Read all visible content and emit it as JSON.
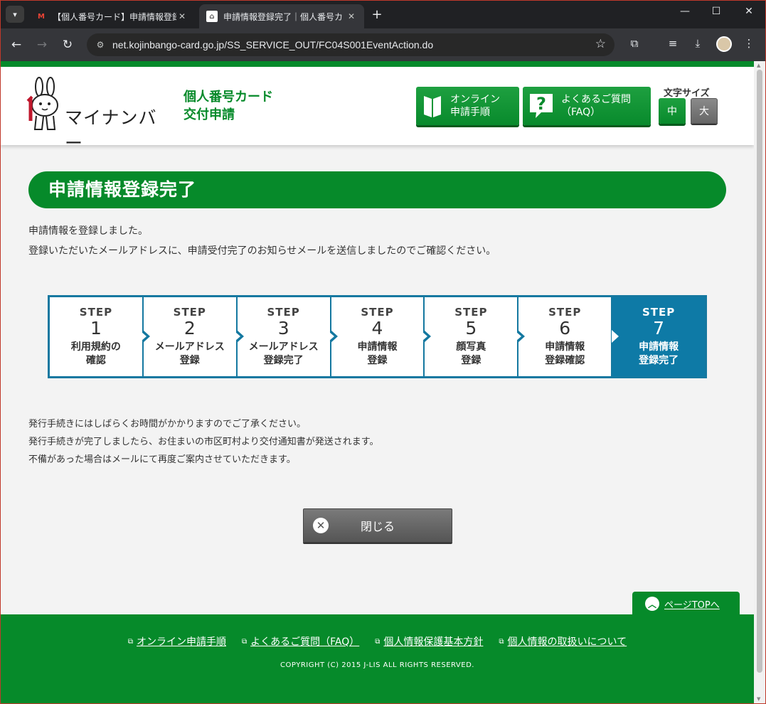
{
  "browser": {
    "tabs": [
      {
        "title": "【個人番号カード】申請情報登録U",
        "favicon": "gmail-icon",
        "active": false
      },
      {
        "title": "申請情報登録完了｜個人番号カ",
        "favicon": "site-icon",
        "active": true
      }
    ],
    "url": "net.kojinbango-card.go.jp/SS_SERVICE_OUT/FC04S001EventAction.do"
  },
  "header": {
    "logo_text": "マイナンバー",
    "service_title_line1": "個人番号カード",
    "service_title_line2": "交付申請",
    "online_btn_line1": "オンライン",
    "online_btn_line2": "申請手順",
    "faq_btn_line1": "よくあるご質問",
    "faq_btn_line2": "（FAQ）",
    "fontsize_label": "文字サイズ",
    "fontsize_medium": "中",
    "fontsize_large": "大"
  },
  "main": {
    "heading": "申請情報登録完了",
    "message1": "申請情報を登録しました。",
    "message2": "登録いただいたメールアドレスに、申請受付完了のお知らせメールを送信しましたのでご確認ください。",
    "steps": [
      {
        "word": "STEP",
        "num": "1",
        "label": "利用規約の\n確認"
      },
      {
        "word": "STEP",
        "num": "2",
        "label": "メールアドレス\n登録"
      },
      {
        "word": "STEP",
        "num": "3",
        "label": "メールアドレス\n登録完了"
      },
      {
        "word": "STEP",
        "num": "4",
        "label": "申請情報\n登録"
      },
      {
        "word": "STEP",
        "num": "5",
        "label": "顔写真\n登録"
      },
      {
        "word": "STEP",
        "num": "6",
        "label": "申請情報\n登録確認"
      },
      {
        "word": "STEP",
        "num": "7",
        "label": "申請情報\n登録完了"
      }
    ],
    "current_step": 7,
    "notes": [
      "発行手続きにはしばらくお時間がかかりますのでご了承ください。",
      "発行手続きが完了しましたら、お住まいの市区町村より交付通知書が発送されます。",
      "不備があった場合はメールにて再度ご案内させていただきます。"
    ],
    "close_button": "閉じる",
    "pagetop": "ページTOPへ"
  },
  "footer": {
    "links": [
      "オンライン申請手順",
      "よくあるご質問（FAQ）",
      "個人情報保護基本方針",
      "個人情報の取扱いについて"
    ],
    "copyright": "COPYRIGHT (C) 2015 J-LIS ALL RIGHTS RESERVED."
  },
  "colors": {
    "brand_green": "#068a2a",
    "step_blue": "#0e7aa6"
  }
}
